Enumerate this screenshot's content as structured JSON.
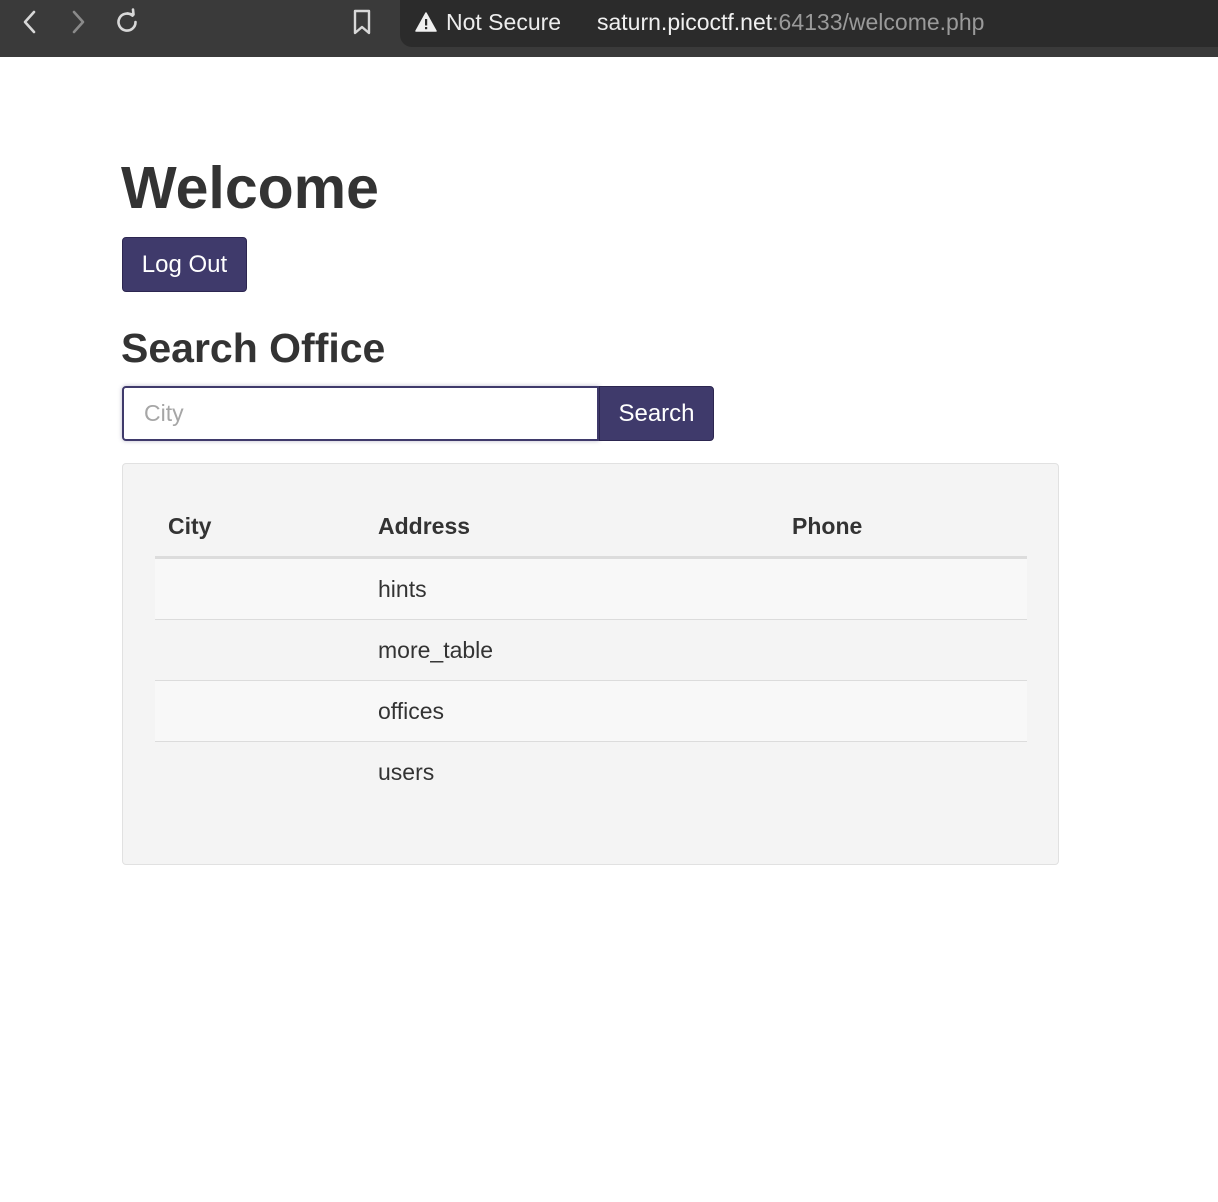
{
  "browser": {
    "security_label": "Not Secure",
    "url_host": "saturn.picoctf.net",
    "url_rest": ":64133/welcome.php",
    "icons": {
      "back": "chevron-left-icon",
      "forward": "chevron-right-icon",
      "reload": "reload-icon",
      "bookmark": "bookmark-icon",
      "warning": "warning-triangle-icon"
    }
  },
  "page": {
    "title": "Welcome",
    "logout_label": "Log Out",
    "search_title": "Search Office",
    "search": {
      "placeholder": "City",
      "value": "",
      "button_label": "Search"
    },
    "table": {
      "headers": [
        "City",
        "Address",
        "Phone"
      ],
      "rows": [
        {
          "city": "",
          "address": "hints",
          "phone": ""
        },
        {
          "city": "",
          "address": "more_table",
          "phone": ""
        },
        {
          "city": "",
          "address": "offices",
          "phone": ""
        },
        {
          "city": "",
          "address": "users",
          "phone": ""
        }
      ]
    }
  },
  "colors": {
    "accent": "#3f3a6b",
    "toolbar_bg": "#3a3a3a",
    "panel_bg": "#f4f4f4"
  }
}
